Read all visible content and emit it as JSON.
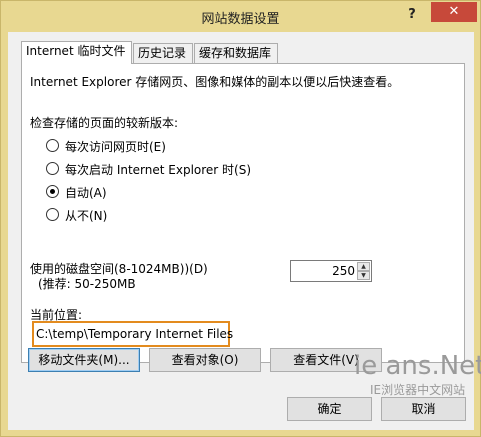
{
  "window": {
    "title": "网站数据设置",
    "help_label": "?",
    "close_label": "✕"
  },
  "tabs": [
    {
      "label": "Internet 临时文件",
      "active": true
    },
    {
      "label": "历史记录",
      "active": false
    },
    {
      "label": "缓存和数据库",
      "active": false
    }
  ],
  "panel": {
    "description": "Internet Explorer 存储网页、图像和媒体的副本以便以后快速查看。",
    "check_label": "检查存储的页面的较新版本:",
    "options": [
      {
        "label": "每次访问网页时(E)",
        "checked": false
      },
      {
        "label": "每次启动 Internet Explorer 时(S)",
        "checked": false
      },
      {
        "label": "自动(A)",
        "checked": true
      },
      {
        "label": "从不(N)",
        "checked": false
      }
    ],
    "disk_label": "使用的磁盘空间(8-1024MB))(D)",
    "disk_hint": "(推荐: 50-250MB",
    "disk_value": "250",
    "location_label": "当前位置:",
    "location_value": "C:\\temp\\Temporary Internet Files"
  },
  "buttons": {
    "move_folder": "移动文件夹(M)...",
    "view_objects": "查看对象(O)",
    "view_files": "查看文件(V)",
    "ok": "确定",
    "cancel": "取消"
  },
  "watermark": {
    "logo": "ie ans.Net",
    "subtitle": "IE浏览器中文网站"
  }
}
